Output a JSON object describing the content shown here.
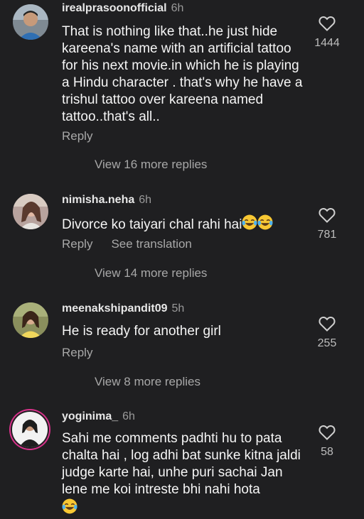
{
  "comments": [
    {
      "username": "irealprasoonofficial",
      "time": "6h",
      "text": "That is nothing like that..he just hide kareena's name with an artificial tattoo for his next movie.in which he is playing a Hindu character . that's why he have a trishul tattoo over kareena named tattoo..that's all..",
      "reply": "Reply",
      "likes": "1444",
      "view_more": "View 16 more replies"
    },
    {
      "username": "nimisha.neha",
      "time": "6h",
      "text": "Divorce ko taiyari chal rahi hai",
      "reply": "Reply",
      "translate": "See translation",
      "likes": "781",
      "view_more": "View 14 more replies"
    },
    {
      "username": "meenakshipandit09",
      "time": "5h",
      "text": "He is ready for another girl",
      "reply": "Reply",
      "likes": "255",
      "view_more": "View 8 more replies"
    },
    {
      "username": "yoginima_",
      "time": "6h",
      "text": "Sahi me comments padhti hu to pata chalta hai , log adhi bat sunke kitna jaldi  judge karte hai, unhe puri sachai Jan lene me koi intreste bhi nahi hota",
      "likes": "58"
    }
  ],
  "icons": {
    "like": "heart-outline-icon",
    "emoji": "laughing-tears-emoji"
  },
  "colors": {
    "background": "#1f1f21",
    "story_ring": "#d7328a"
  }
}
